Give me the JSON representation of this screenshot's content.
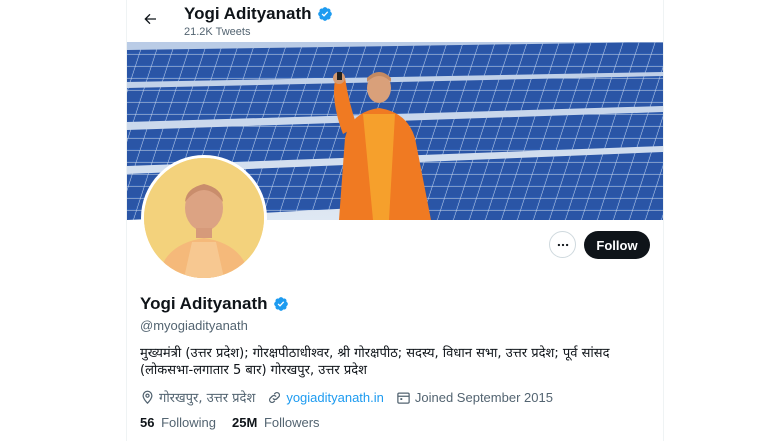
{
  "header": {
    "name": "Yogi Adityanath",
    "tweet_count": "21.2K Tweets"
  },
  "profile": {
    "name": "Yogi Adityanath",
    "handle": "@myogiadityanath",
    "bio": "मुख्यमंत्री (उत्तर प्रदेश); गोरक्षपीठाधीश्वर, श्री गोरक्षपीठ; सदस्य, विधान सभा, उत्तर प्रदेश; पूर्व सांसद (लोकसभा-लगातार 5 बार) गोरखपुर, उत्तर प्रदेश",
    "location": "गोरखपुर, उत्तर प्रदेश",
    "website": "yogiadityanath.in",
    "joined": "Joined September 2015"
  },
  "stats": {
    "following_count": "56",
    "following_label": "Following",
    "followers_count": "25M",
    "followers_label": "Followers"
  },
  "buttons": {
    "follow_label": "Follow"
  },
  "icons": {
    "back": "arrow-left-icon",
    "verified": "verified-badge-icon",
    "more": "more-horizontal-icon",
    "location": "location-pin-icon",
    "link": "link-icon",
    "calendar": "calendar-icon"
  },
  "colors": {
    "accent": "#1d9bf0",
    "text": "#0f1419",
    "secondary": "#536471",
    "follow_button": "#0f1419"
  }
}
